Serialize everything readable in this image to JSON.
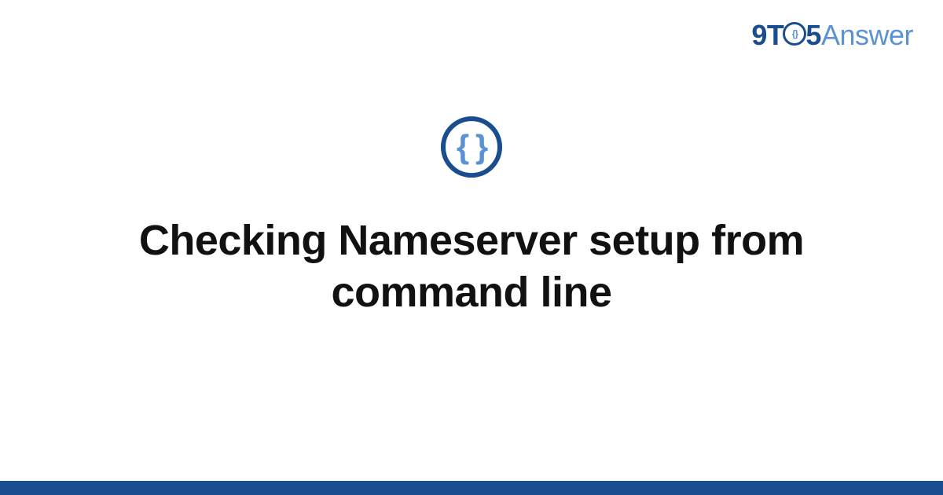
{
  "brand": {
    "part1": "9T",
    "ring_inner": "{}",
    "part2": "5",
    "part3": "Answer"
  },
  "icon": {
    "glyph": "{ }"
  },
  "page": {
    "title": "Checking Nameserver setup from command line"
  },
  "colors": {
    "dark_blue": "#1a4d8f",
    "light_blue": "#5b92d4",
    "text": "#111111",
    "bg": "#ffffff"
  }
}
